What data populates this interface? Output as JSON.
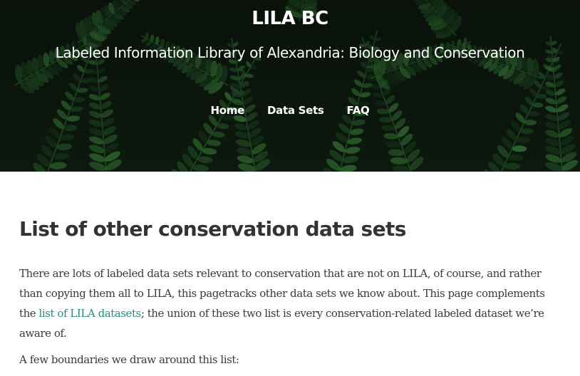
{
  "header": {
    "site_title": "LILA BC",
    "tagline": "Labeled Information Library of Alexandria: Biology and Conservation"
  },
  "nav": {
    "items": [
      {
        "label": "Home"
      },
      {
        "label": "Data Sets"
      },
      {
        "label": "FAQ"
      }
    ]
  },
  "main": {
    "title": "List of other conservation data sets",
    "intro_before_link": "There are lots of labeled data sets relevant to conservation that are not on LILA, of course, and rather than copying them all to LILA, this pagetracks other data sets we know about. This page complements the ",
    "intro_link": "list of LILA datasets",
    "intro_after_link": "; the union of these two list is every conservation-related labeled dataset we’re aware of.",
    "second_paragraph": "A few boundaries we draw around this list:"
  },
  "colors": {
    "link": "#2a8a7a",
    "heading": "#333333",
    "body_text": "#3a3a3a",
    "hero_overlay": "#0f1c10"
  }
}
